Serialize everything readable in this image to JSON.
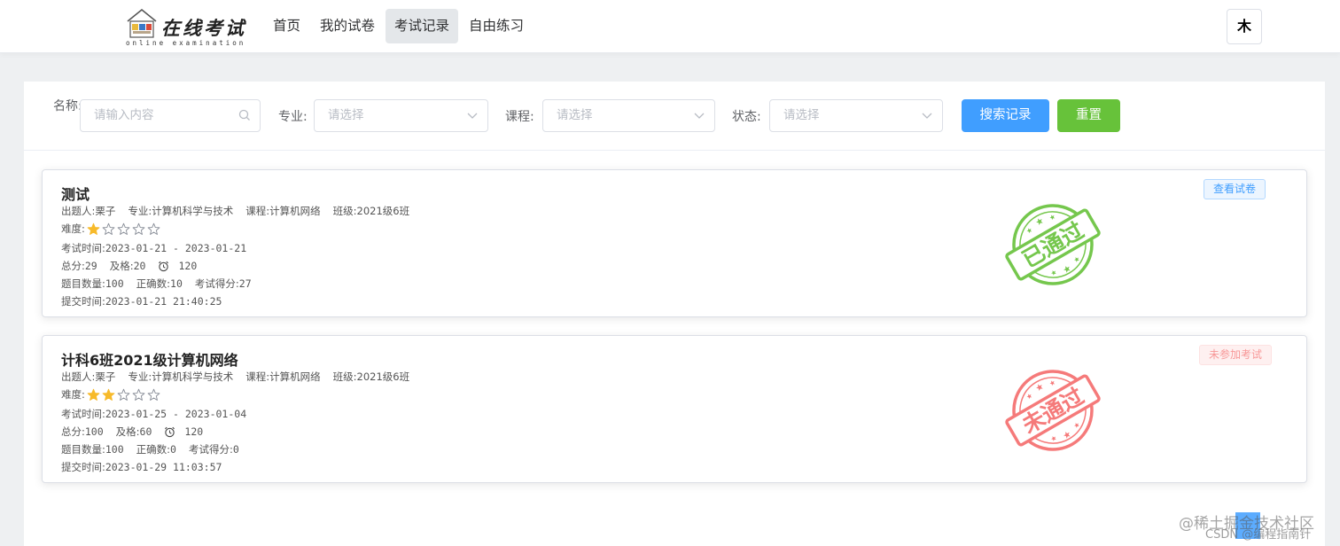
{
  "header": {
    "logo_title": "在线考试",
    "logo_subtitle": "online examination",
    "nav": [
      {
        "label": "首页",
        "active": false
      },
      {
        "label": "我的试卷",
        "active": false
      },
      {
        "label": "考试记录",
        "active": true
      },
      {
        "label": "自由练习",
        "active": false
      }
    ],
    "avatar_text": "木"
  },
  "filters": {
    "name_label": "名称:",
    "name_placeholder": "请输入内容",
    "major_label": "专业:",
    "major_placeholder": "请选择",
    "course_label": "课程:",
    "course_placeholder": "请选择",
    "status_label": "状态:",
    "status_placeholder": "请选择",
    "search_button": "搜索记录",
    "reset_button": "重置"
  },
  "records": [
    {
      "title": "测试",
      "creator_label": "出题人:",
      "creator": "栗子",
      "major_label": "专业:",
      "major": "计算机科学与技术",
      "course_label": "课程:",
      "course": "计算机网络",
      "class_label": "班级:",
      "class": "2021级6班",
      "difficulty_label": "难度:",
      "difficulty": 1,
      "difficulty_max": 5,
      "exam_time_label": "考试时间:",
      "exam_time": "2023-01-21 - 2023-01-21",
      "total_label": "总分:",
      "total": "29",
      "pass_label": "及格:",
      "pass": "20",
      "duration": "120",
      "question_count_label": "题目数量:",
      "question_count": "100",
      "correct_label": "正确数:",
      "correct": "10",
      "score_label": "考试得分:",
      "score": "27",
      "submit_label": "提交时间:",
      "submit_time": "2023-01-21 21:40:25",
      "tag": "查看试卷",
      "stamp_text": "已通过",
      "stamp_color": "#67c23a"
    },
    {
      "title": "计科6班2021级计算机网络",
      "creator_label": "出题人:",
      "creator": "栗子",
      "major_label": "专业:",
      "major": "计算机科学与技术",
      "course_label": "课程:",
      "course": "计算机网络",
      "class_label": "班级:",
      "class": "2021级6班",
      "difficulty_label": "难度:",
      "difficulty": 2,
      "difficulty_max": 5,
      "exam_time_label": "考试时间:",
      "exam_time": "2023-01-25 - 2023-01-04",
      "total_label": "总分:",
      "total": "100",
      "pass_label": "及格:",
      "pass": "60",
      "duration": "120",
      "question_count_label": "题目数量:",
      "question_count": "100",
      "correct_label": "正确数:",
      "correct": "0",
      "score_label": "考试得分:",
      "score": "0",
      "submit_label": "提交时间:",
      "submit_time": "2023-01-29 11:03:57",
      "tag": "未参加考试",
      "stamp_text": "未通过",
      "stamp_color": "#f56c6c"
    }
  ],
  "watermark": {
    "text": "@稀土掘金技术社区",
    "text2": "CSDN @编程指南针"
  },
  "colors": {
    "primary": "#409eff",
    "success": "#67c23a",
    "danger": "#f56c6c",
    "star": "#f7ba2a"
  }
}
